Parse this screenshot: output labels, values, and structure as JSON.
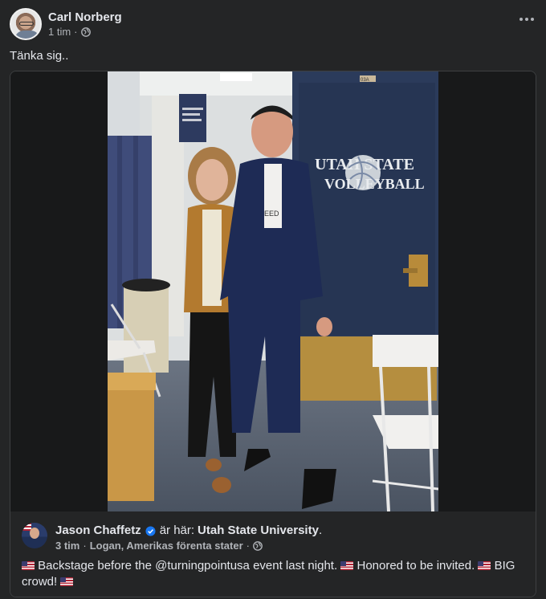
{
  "post": {
    "author": "Carl Norberg",
    "time": "1 tim",
    "separator": "·",
    "text": "Tänka sig.."
  },
  "shared": {
    "author": "Jason Chaffetz",
    "checkin_prefix": "är här:",
    "place": "Utah State University",
    "place_suffix": ".",
    "time": "3 tim",
    "sep1": "·",
    "location": "Logan, Amerikas förenta stater",
    "sep2": "·",
    "text_1": " Backstage before the @turningpointusa event last night. ",
    "text_2": " Honored to be invited. ",
    "text_3": " BIG crowd! "
  },
  "photo": {
    "door_sign_line1": "UTAH STATE",
    "door_sign_line2": "VOLLEYBALL",
    "room_number": "03A",
    "shirt_text": "EED"
  },
  "colors": {
    "background": "#242526",
    "text_primary": "#e4e6eb",
    "text_secondary": "#b0b3b8",
    "verified": "#1877f2"
  },
  "icons": [
    "globe-icon",
    "more-options-icon",
    "verified-badge-icon",
    "us-flag-icon"
  ]
}
